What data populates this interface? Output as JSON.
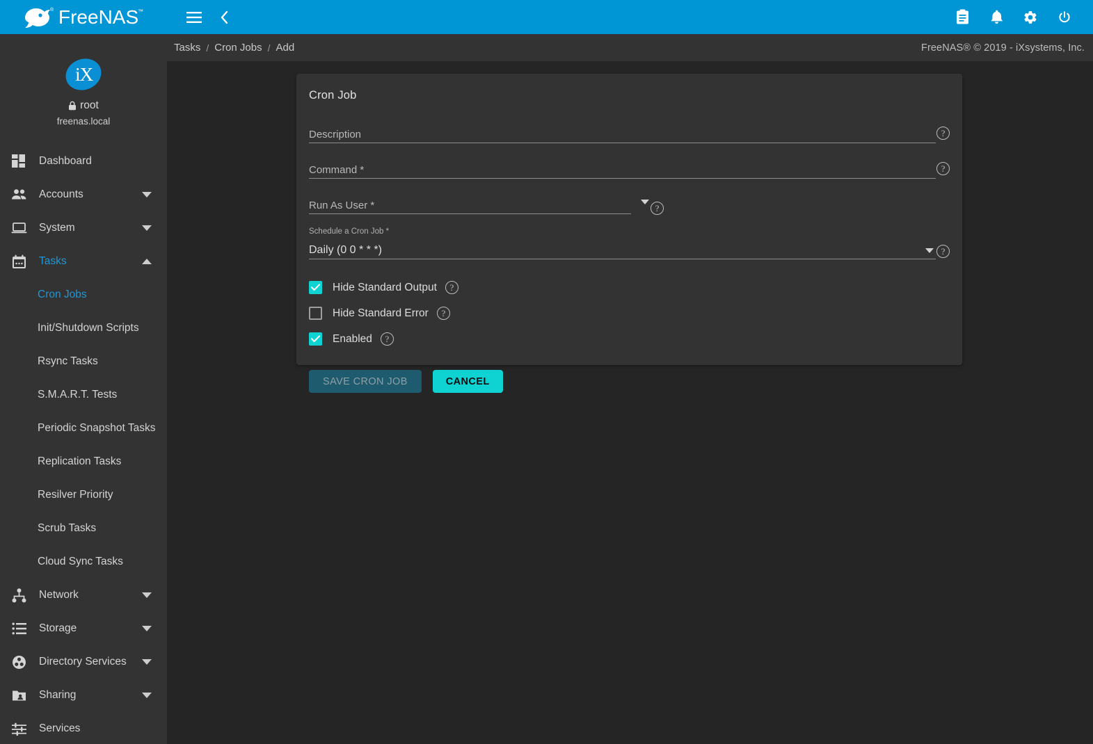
{
  "topbar": {
    "brand": "FreeNAS",
    "menu_icon": "hamburger-icon",
    "back_icon": "chevron-left-icon",
    "right_icons": [
      {
        "name": "clipboard-icon",
        "label": "Tasks Manager"
      },
      {
        "name": "bell-icon",
        "label": "Alerts"
      },
      {
        "name": "gear-icon",
        "label": "Settings"
      },
      {
        "name": "power-icon",
        "label": "Power"
      }
    ],
    "accent_color": "#0095D5"
  },
  "breadcrumb": {
    "items": [
      "Tasks",
      "Cron Jobs",
      "Add"
    ],
    "separator": "/",
    "copyright": "FreeNAS® © 2019 - iXsystems, Inc."
  },
  "sidebar": {
    "logo_text": "iX",
    "username": "root",
    "hostname": "freenas.local",
    "lock_icon": "lock-icon",
    "items": [
      {
        "label": "Dashboard",
        "icon": "dashboard-icon",
        "expandable": false,
        "active": false
      },
      {
        "label": "Accounts",
        "icon": "people-icon",
        "expandable": true,
        "expanded": false,
        "active": false
      },
      {
        "label": "System",
        "icon": "laptop-icon",
        "expandable": true,
        "expanded": false,
        "active": false
      },
      {
        "label": "Tasks",
        "icon": "calendar-icon",
        "expandable": true,
        "expanded": true,
        "active": true
      },
      {
        "label": "Network",
        "icon": "network-icon",
        "expandable": true,
        "expanded": false,
        "active": false
      },
      {
        "label": "Storage",
        "icon": "storage-icon",
        "expandable": true,
        "expanded": false,
        "active": false
      },
      {
        "label": "Directory Services",
        "icon": "directory-icon",
        "expandable": true,
        "expanded": false,
        "active": false
      },
      {
        "label": "Sharing",
        "icon": "sharing-icon",
        "expandable": true,
        "expanded": false,
        "active": false
      },
      {
        "label": "Services",
        "icon": "services-icon",
        "expandable": false,
        "active": false
      }
    ],
    "tasks_subitems": [
      {
        "label": "Cron Jobs",
        "active": true
      },
      {
        "label": "Init/Shutdown Scripts",
        "active": false
      },
      {
        "label": "Rsync Tasks",
        "active": false
      },
      {
        "label": "S.M.A.R.T. Tests",
        "active": false
      },
      {
        "label": "Periodic Snapshot Tasks",
        "active": false
      },
      {
        "label": "Replication Tasks",
        "active": false
      },
      {
        "label": "Resilver Priority",
        "active": false
      },
      {
        "label": "Scrub Tasks",
        "active": false
      },
      {
        "label": "Cloud Sync Tasks",
        "active": false
      }
    ]
  },
  "form": {
    "title": "Cron Job",
    "fields": [
      {
        "label": "Description",
        "value": "",
        "type": "text",
        "required": false
      },
      {
        "label": "Command *",
        "value": "",
        "type": "text",
        "required": true
      },
      {
        "label": "Run As User *",
        "value": "",
        "type": "select",
        "required": true
      },
      {
        "label": "Schedule a Cron Job *",
        "value": "Daily (0 0 * * *)",
        "type": "select",
        "required": true
      }
    ],
    "checkboxes": [
      {
        "label": "Hide Standard Output",
        "checked": true
      },
      {
        "label": "Hide Standard Error",
        "checked": false
      },
      {
        "label": "Enabled",
        "checked": true
      }
    ],
    "buttons": {
      "save": "SAVE CRON JOB",
      "save_disabled": true,
      "cancel": "CANCEL"
    },
    "help_icon_glyph": "?",
    "colors": {
      "checkbox_on": "#0FD2D2",
      "cancel_button": "#0FD2D2",
      "save_button_disabled": "#1F5B6E",
      "card_background": "#333333",
      "page_background": "#252525"
    }
  }
}
